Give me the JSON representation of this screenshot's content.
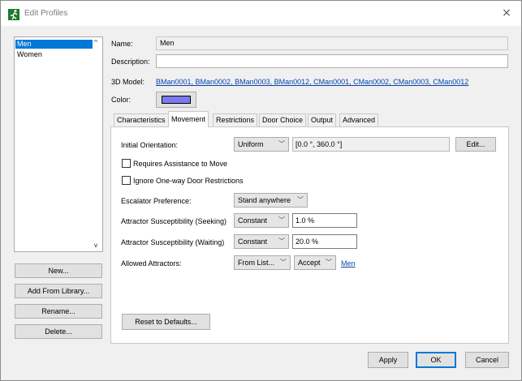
{
  "window": {
    "title": "Edit Profiles",
    "close_glyph": "×",
    "icon": "running-man-icon"
  },
  "profiles": {
    "items": [
      "Men",
      "Women"
    ],
    "selected": "Men",
    "scroll_up": "^",
    "scroll_down": "v"
  },
  "list_buttons": {
    "new": "New...",
    "add_from_library": "Add From Library...",
    "rename": "Rename...",
    "delete": "Delete..."
  },
  "details": {
    "name_label": "Name:",
    "name_value": "Men",
    "description_label": "Description:",
    "description_value": "",
    "model_label": "3D Model:",
    "model_value": "BMan0001, BMan0002, BMan0003, BMan0012, CMan0001, CMan0002, CMan0003, CMan0012",
    "color_label": "Color:",
    "color_value": "#7b7bef"
  },
  "tabs": [
    "Characteristics",
    "Movement",
    "Restrictions",
    "Door Choice",
    "Output",
    "Advanced"
  ],
  "active_tab": "Movement",
  "movement": {
    "initial_orientation_label": "Initial Orientation:",
    "initial_orientation_mode": "Uniform",
    "initial_orientation_value": "[0.0 °, 360.0 °]",
    "edit_button": "Edit...",
    "requires_assistance_label": "Requires Assistance to Move",
    "requires_assistance_checked": false,
    "ignore_oneway_label": "Ignore One-way Door Restrictions",
    "ignore_oneway_checked": false,
    "escalator_label": "Escalator Preference:",
    "escalator_value": "Stand anywhere",
    "attractor_seeking_label": "Attractor Susceptibility (Seeking)",
    "attractor_seeking_mode": "Constant",
    "attractor_seeking_value": "1.0 %",
    "attractor_waiting_label": "Attractor Susceptibility (Waiting)",
    "attractor_waiting_mode": "Constant",
    "attractor_waiting_value": "20.0 %",
    "allowed_attractors_label": "Allowed Attractors:",
    "allowed_attractors_mode": "From List...",
    "allowed_attractors_action": "Accept",
    "allowed_attractors_link": "Men",
    "reset_button": "Reset to Defaults..."
  },
  "footer": {
    "apply": "Apply",
    "ok": "OK",
    "cancel": "Cancel"
  }
}
